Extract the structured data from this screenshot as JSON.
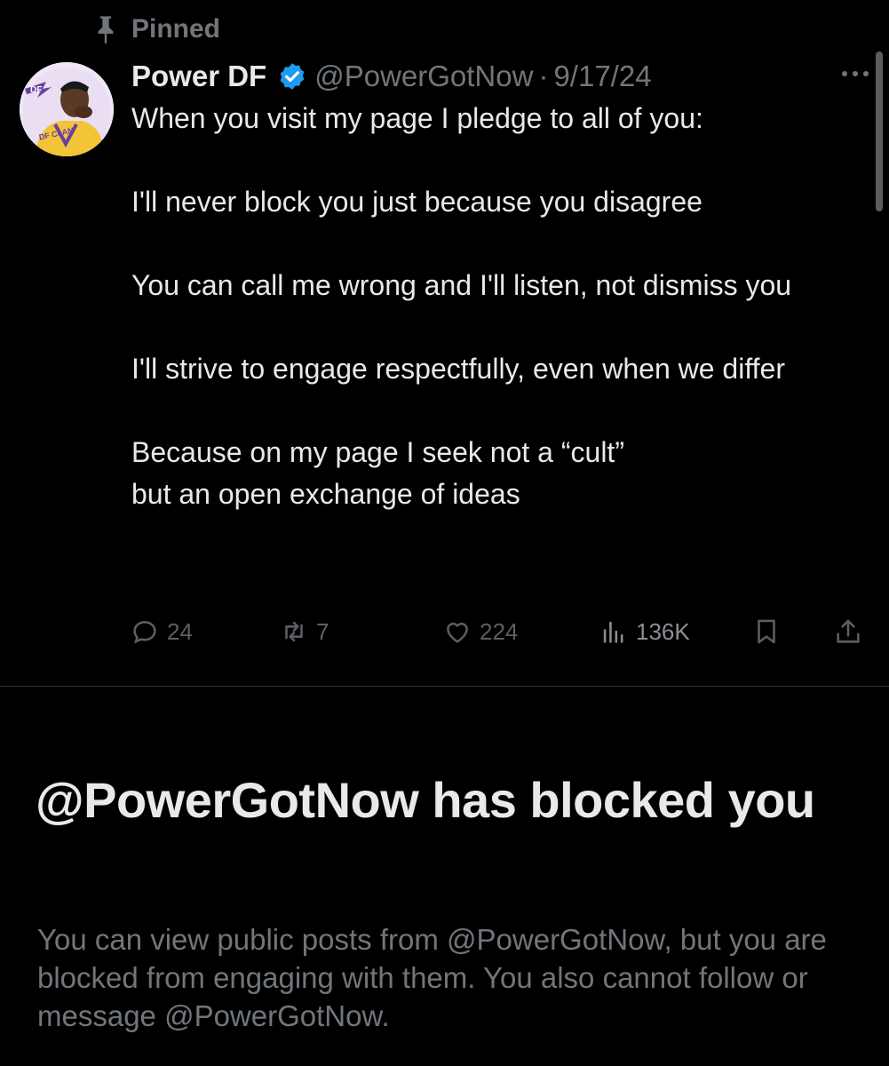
{
  "pinned_label": "Pinned",
  "tweet": {
    "display_name": "Power DF",
    "handle": "@PowerGotNow",
    "separator": "·",
    "date": "9/17/24",
    "paragraphs": [
      "When you visit my page I pledge to all of you:",
      "I'll never block you just because you disagree",
      "You can call me wrong and I'll listen, not dismiss you",
      "I'll strive to engage respectfully, even when we differ",
      "Because on my page I seek not a “cult”\nbut an open exchange of ideas"
    ],
    "stats": {
      "replies": "24",
      "reposts": "7",
      "likes": "224",
      "views": "136K"
    },
    "avatar_text": "DF CLAN"
  },
  "blocked": {
    "title": "@PowerGotNow has blocked you",
    "description": "You can view public posts from @PowerGotNow, but you are blocked from engaging with them. You also cannot follow or message @PowerGotNow."
  },
  "colors": {
    "background": "#000000",
    "primary_text": "#e7e9ea",
    "secondary_text": "#71767b",
    "verified": "#1d9bf0",
    "divider": "#2f3336"
  },
  "icons": [
    "pin-icon",
    "verified-badge-icon",
    "more-icon",
    "reply-icon",
    "repost-icon",
    "like-icon",
    "views-icon",
    "bookmark-icon",
    "share-icon"
  ]
}
